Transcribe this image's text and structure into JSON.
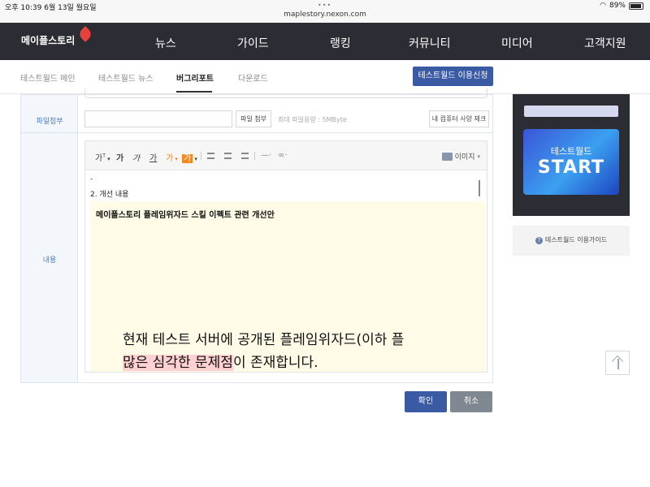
{
  "status": {
    "time_date": "오후 10:39   6월 13일 월요일",
    "battery": "89%",
    "url": "maplestory.nexon.com"
  },
  "nav": {
    "logo": "메이플스토리",
    "items": [
      "뉴스",
      "가이드",
      "랭킹",
      "커뮤니티",
      "미디어",
      "고객지원"
    ]
  },
  "subtabs": {
    "items": [
      "테스트월드 메인",
      "테스트월드 뉴스",
      "버그리포트",
      "다운로드"
    ],
    "active": "버그리포트",
    "apply_button": "테스트월드 이용신청"
  },
  "form": {
    "file_label": "파일첨부",
    "file_button": "파일 첨부",
    "file_limit": "최대 파일용량 : 5MByte",
    "spec_button": "내 컴퓨터 사양 체크",
    "content_label": "내용"
  },
  "editor": {
    "toolbar": {
      "font_size": "가",
      "bold": "가",
      "italic": "가",
      "underline": "가",
      "font_color": "가",
      "bg_color": "가",
      "image": "이미지"
    },
    "dash": "-",
    "section_title": "2. 개선 내용",
    "box_title": "메이플스토리 플레임위자드 스킬 이펙트 관련 개선안",
    "big_line1": "현재 테스트 서버에 공개된 플레임위자드(이하 플",
    "big_line2_hl": "많은 심각한 문제점",
    "big_line2_rest": "이 존재합니다."
  },
  "actions": {
    "ok": "확인",
    "cancel": "취소"
  },
  "sidebar": {
    "start_sub": "테스트월드",
    "start_main": "START",
    "guide": "테스트월드 이용가이드"
  }
}
